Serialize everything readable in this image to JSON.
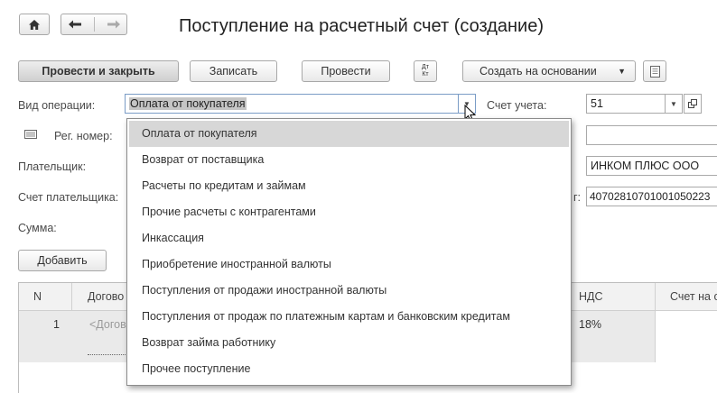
{
  "nav": {
    "home_icon": "home-icon",
    "back_icon": "arrow-left-icon",
    "forward_icon": "arrow-right-icon"
  },
  "window": {
    "title": "Поступление на расчетный счет (создание)"
  },
  "toolbar": {
    "post_close_label": "Провести и закрыть",
    "save_label": "Записать",
    "post_label": "Провести",
    "dtkt_top": "Дт",
    "dtkt_bottom": "Кт",
    "create_based_label": "Создать на основании"
  },
  "form": {
    "operation_type_label": "Вид операции:",
    "operation_type_value": "Оплата от покупателя",
    "account_label": "Счет учета:",
    "account_value": "51",
    "reg_number_label": "Рег. номер:",
    "payer_label": "Плательщик:",
    "payer_account_label": "Счет плательщика:",
    "amount_label": "Сумма:",
    "org_value": "ИНКОМ ПЛЮС ООО",
    "bank_account_label_tail": "г:",
    "bank_account_value": "40702810701001050223"
  },
  "add_button_label": "Добавить",
  "dropdown": {
    "items": [
      "Оплата от покупателя",
      "Возврат от поставщика",
      "Расчеты по кредитам и займам",
      "Прочие расчеты с контрагентами",
      "Инкассация",
      "Приобретение иностранной валюты",
      "Поступления от продажи иностранной валюты",
      "Поступления от продаж по платежным картам и банковским кредитам",
      "Возврат займа работнику",
      "Прочее поступление"
    ]
  },
  "table": {
    "columns": {
      "n": "N",
      "contract": "Догово",
      "vat": "НДС",
      "account": "Счет на о"
    },
    "row": {
      "n": "1",
      "contract": "<Догов",
      "vat": "18%"
    }
  }
}
